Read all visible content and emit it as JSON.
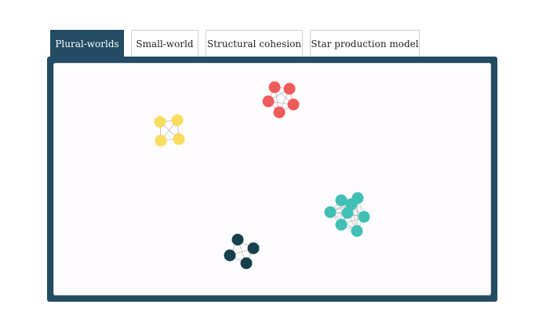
{
  "tabs": [
    {
      "label": "Plural-worlds",
      "active": true
    },
    {
      "label": "Small-world",
      "active": false
    },
    {
      "label": "Structural cohesion",
      "active": false
    },
    {
      "label": "Star production model",
      "active": false
    }
  ],
  "colors": {
    "frame": "#234b63",
    "canvas": "#fefcfe",
    "edge": "#b9b9b9",
    "cluster_yellow": "#f9dc5c",
    "cluster_red": "#ef5b5b",
    "cluster_teal": "#3fbfb5",
    "cluster_navy": "#16404d"
  },
  "clusters": [
    {
      "name": "yellow",
      "color_key": "cluster_yellow",
      "node_count": 4
    },
    {
      "name": "red",
      "color_key": "cluster_red",
      "node_count": 5
    },
    {
      "name": "teal",
      "color_key": "cluster_teal",
      "node_count": 8
    },
    {
      "name": "navy",
      "color_key": "cluster_navy",
      "node_count": 4
    }
  ]
}
